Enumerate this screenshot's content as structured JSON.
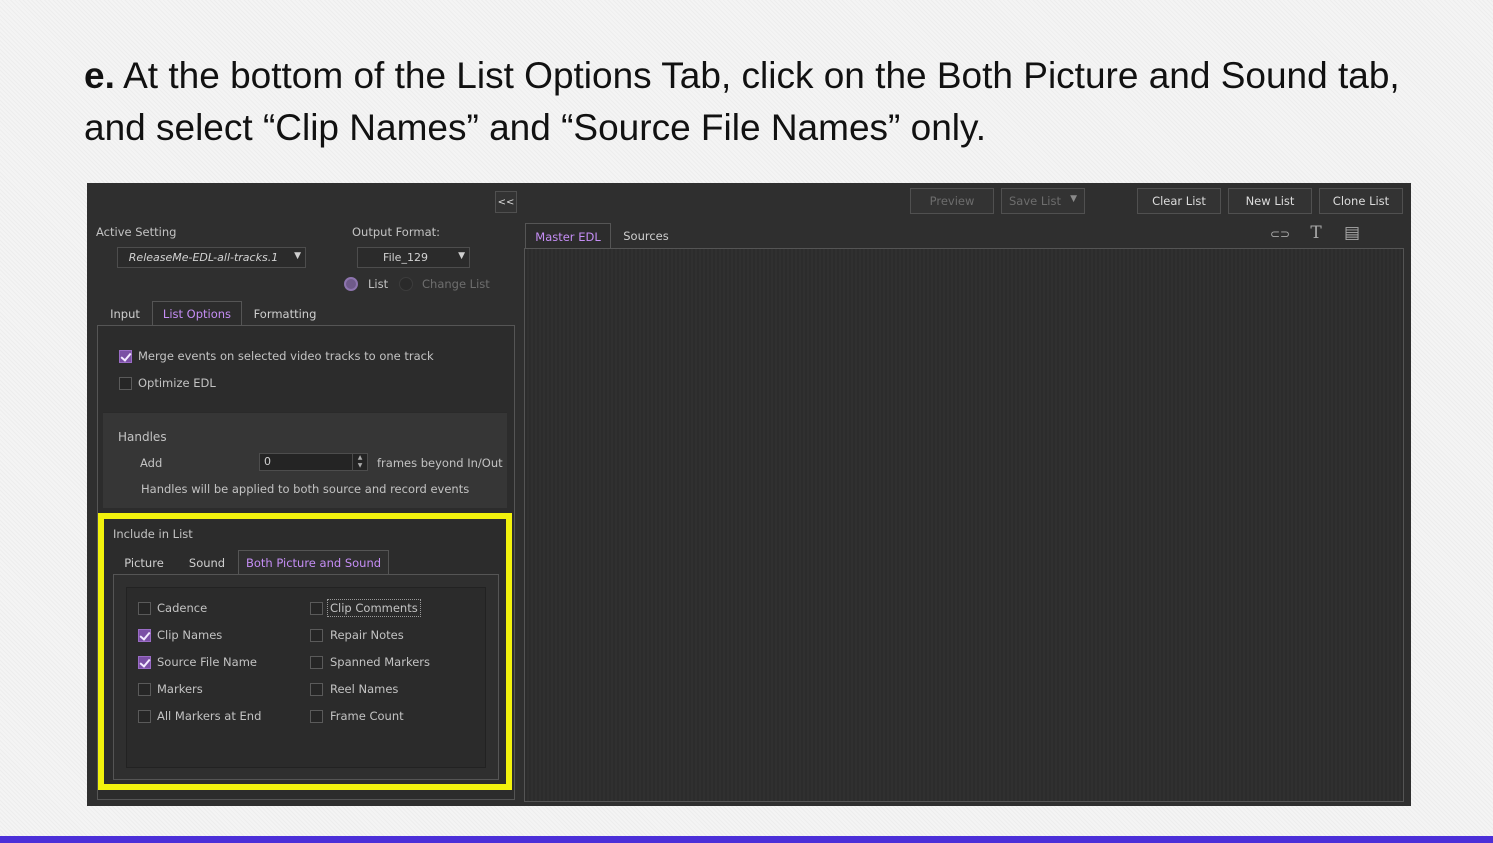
{
  "instruction": {
    "step": "e.",
    "text": "At the bottom of the List Options Tab, click on the Both Picture and Sound tab, and select “Clip Names” and “Source File Names” only."
  },
  "toolbar": {
    "collapse_label": "<<",
    "preview_label": "Preview",
    "save_list_label": "Save List",
    "clear_list_label": "Clear List",
    "new_list_label": "New List",
    "clone_list_label": "Clone List"
  },
  "settings": {
    "active_setting_label": "Active Setting",
    "active_setting_value": "ReleaseMe-EDL-all-tracks.1",
    "output_format_label": "Output Format:",
    "output_format_value": "File_129",
    "radio_list_label": "List",
    "radio_change_list_label": "Change List"
  },
  "tabs": {
    "input": "Input",
    "list_options": "List Options",
    "formatting": "Formatting"
  },
  "list_options": {
    "merge_events_label": "Merge events on selected video tracks to one track",
    "merge_events_checked": true,
    "optimize_edl_label": "Optimize EDL",
    "optimize_edl_checked": false
  },
  "handles": {
    "title": "Handles",
    "add_label": "Add",
    "add_value": "0",
    "frames_label": "frames beyond In/Out",
    "note": "Handles will be applied to both source and record events"
  },
  "include": {
    "title": "Include in List",
    "tabs": {
      "picture": "Picture",
      "sound": "Sound",
      "both": "Both Picture and Sound"
    },
    "left": [
      {
        "label": "Cadence",
        "checked": false
      },
      {
        "label": "Clip Names",
        "checked": true
      },
      {
        "label": "Source File Name",
        "checked": true
      },
      {
        "label": "Markers",
        "checked": false
      },
      {
        "label": "All Markers at End",
        "checked": false
      }
    ],
    "right": [
      {
        "label": "Clip Comments",
        "checked": false
      },
      {
        "label": "Repair Notes",
        "checked": false
      },
      {
        "label": "Spanned Markers",
        "checked": false
      },
      {
        "label": "Reel Names",
        "checked": false
      },
      {
        "label": "Frame Count",
        "checked": false
      }
    ]
  },
  "edl_tabs": {
    "master": "Master EDL",
    "sources": "Sources"
  },
  "colors": {
    "accent": "#c58ef5",
    "highlight": "#f2f20d",
    "bottom_bar": "#4b2fd8"
  }
}
